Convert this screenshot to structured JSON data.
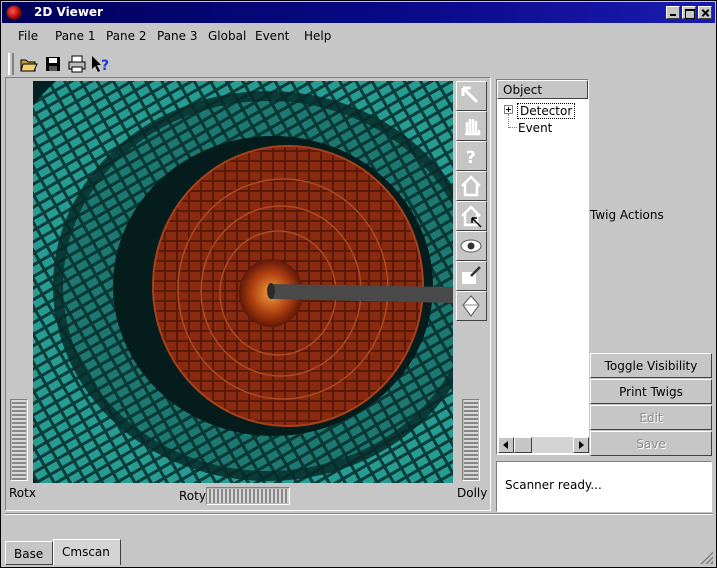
{
  "window": {
    "title": "2D Viewer",
    "controls": [
      "minimize-icon",
      "maximize-icon",
      "close-icon"
    ]
  },
  "menu": {
    "file": "File",
    "pane1": "Pane 1",
    "pane2": "Pane 2",
    "pane3": "Pane 3",
    "global": "Global",
    "event": "Event",
    "help": "Help"
  },
  "toolbar": {
    "icons": [
      "open-folder-icon",
      "save-disk-icon",
      "print-icon",
      "whats-this-help-icon"
    ]
  },
  "viewer_tools": {
    "icons": [
      "select-arrow-icon",
      "pan-hand-icon",
      "query-question-icon",
      "home-icon",
      "set-home-icon",
      "view-eye-icon",
      "seek-pointer-icon",
      "perspective-icon"
    ]
  },
  "sliders": {
    "rotx": "Rotx",
    "roty": "Roty",
    "dolly": "Dolly"
  },
  "tree": {
    "header": "Object",
    "items": [
      {
        "label": "Detector",
        "expandable": true
      },
      {
        "label": "Event",
        "expandable": false
      }
    ]
  },
  "twig": {
    "actions_label": "Twig Actions",
    "buttons": {
      "toggle": "Toggle Visibility",
      "print": "Print Twigs",
      "edit": "Edit",
      "save": "Save"
    }
  },
  "status": {
    "text": "Scanner ready..."
  },
  "tabs": [
    {
      "label": "Base",
      "active": false
    },
    {
      "label": "Cmscan",
      "active": true
    }
  ],
  "colors": {
    "titlebar": "#0a0a8c",
    "background": "#c6c6c6",
    "detector_teal": "#2aa9a0",
    "detector_red": "#8a2a10",
    "viewport_bg": "#002222"
  }
}
